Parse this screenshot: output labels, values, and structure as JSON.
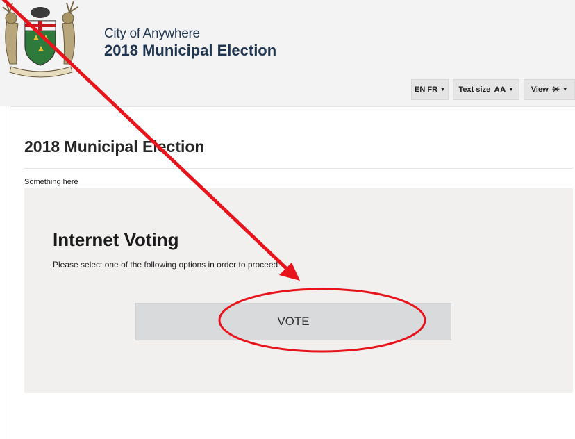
{
  "header": {
    "city_name": "City of Anywhere",
    "election_title": "2018 Municipal Election",
    "controls": {
      "language_label": "EN FR",
      "text_size_label": "Text size",
      "text_size_glyph": "AA",
      "view_label": "View"
    }
  },
  "main": {
    "heading": "2018 Municipal Election",
    "intro_text": "Something here",
    "panel": {
      "title": "Internet Voting",
      "subtitle": "Please select one of the following options in order to proceed",
      "vote_label": "VOTE"
    }
  },
  "annotation": {
    "color": "#e8141c",
    "shapes": [
      "arrow",
      "ellipse"
    ]
  },
  "icons": [
    "coat-of-arms-logo",
    "caret-down-icon",
    "sun-icon"
  ]
}
